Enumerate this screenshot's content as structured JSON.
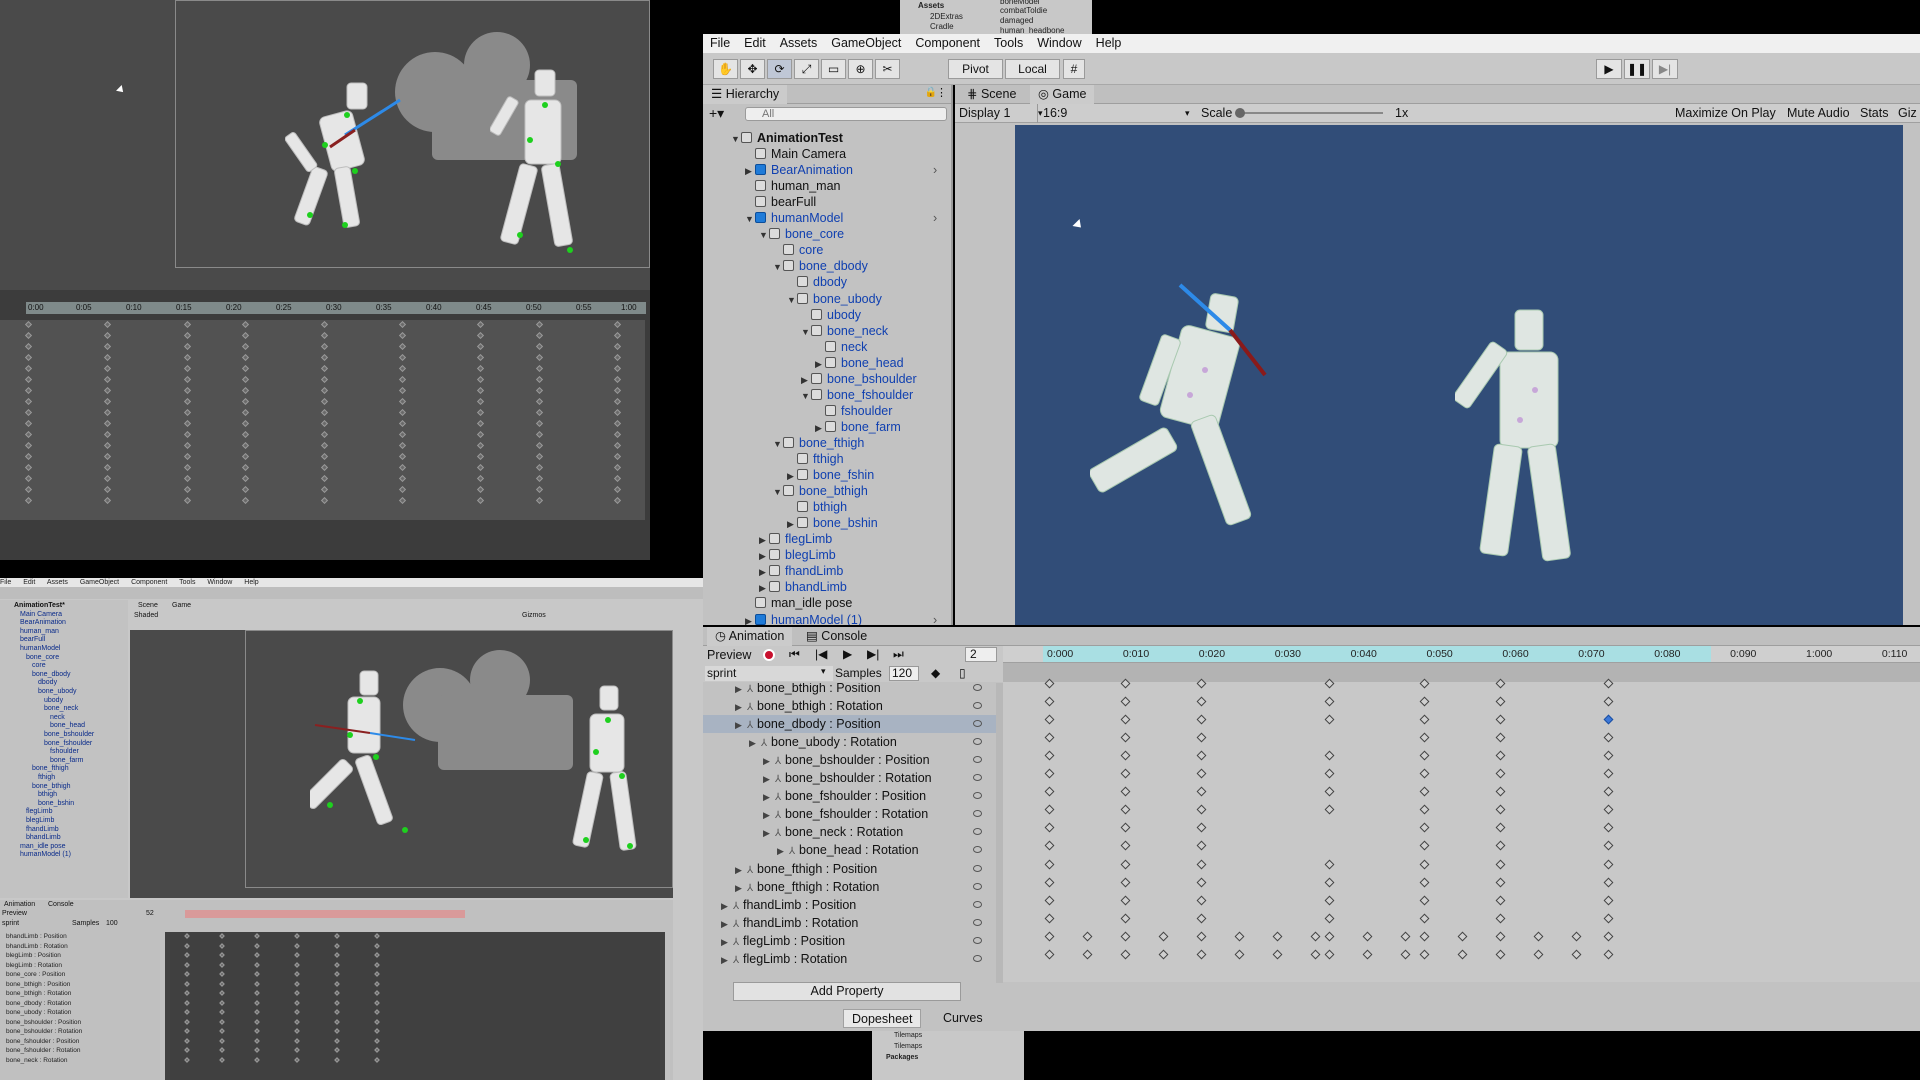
{
  "top_left": {
    "ruler_labels": [
      "0:00",
      "0:05",
      "0:10",
      "0:15",
      "0:20",
      "0:25",
      "0:30",
      "0:35",
      "0:40",
      "0:45",
      "0:50",
      "0:55",
      "1:00"
    ]
  },
  "bottom_left": {
    "menu": [
      "File",
      "Edit",
      "Assets",
      "GameObject",
      "Component",
      "Tools",
      "Window",
      "Help"
    ],
    "hierarchy": [
      "AnimationTest*",
      "Main Camera",
      "BearAnimation",
      "human_man",
      "bearFull",
      "humanModel",
      "bone_core",
      "core",
      "bone_dbody",
      "dbody",
      "bone_ubody",
      "ubody",
      "bone_neck",
      "neck",
      "bone_head",
      "bone_bshoulder",
      "bone_fshoulder",
      "fshoulder",
      "bone_farm",
      "bone_fthigh",
      "fthigh",
      "bone_bthigh",
      "bthigh",
      "bone_bshin",
      "flegLimb",
      "blegLimb",
      "fhandLimb",
      "bhandLimb",
      "man_idle pose",
      "humanModel (1)"
    ],
    "scene_tabs": [
      "Scene",
      "Game"
    ],
    "shading": "Shaded",
    "gizmos": "Gizmos",
    "anim_tabs": [
      "Animation",
      "Console"
    ],
    "preview": "Preview",
    "clip": "sprint",
    "samples_label": "Samples",
    "samples": "100",
    "frame": "52",
    "props": [
      "bhandLimb : Position",
      "bhandLimb : Rotation",
      "blegLimb : Position",
      "blegLimb : Rotation",
      "bone_core : Position",
      "bone_bthigh : Position",
      "bone_bthigh : Rotation",
      "bone_dbody : Rotation",
      "bone_ubody : Rotation",
      "bone_bshoulder : Position",
      "bone_bshoulder : Rotation",
      "bone_fshoulder : Position",
      "bone_fshoulder : Rotation",
      "bone_neck : Rotation"
    ]
  },
  "project_strip": {
    "items": [
      "Assets",
      "2DExtras",
      "Cradle",
      "boneModel",
      "combatToldie",
      "damaged",
      "human_headbone"
    ]
  },
  "menubar": [
    "File",
    "Edit",
    "Assets",
    "GameObject",
    "Component",
    "Tools",
    "Window",
    "Help"
  ],
  "toolbar": {
    "pivot": "Pivot",
    "local": "Local"
  },
  "hierarchy": {
    "tab": "Hierarchy",
    "search_placeholder": "All",
    "items": [
      {
        "label": "AnimationTest",
        "depth": 0,
        "expand": "open",
        "icon": "scene",
        "bold": true
      },
      {
        "label": "Main Camera",
        "depth": 1,
        "expand": "none",
        "icon": "cube"
      },
      {
        "label": "BearAnimation",
        "depth": 1,
        "expand": "closed",
        "icon": "prefab",
        "blue": true,
        "arrow": true
      },
      {
        "label": "human_man",
        "depth": 1,
        "expand": "none",
        "icon": "cube"
      },
      {
        "label": "bearFull",
        "depth": 1,
        "expand": "none",
        "icon": "cube"
      },
      {
        "label": "humanModel",
        "depth": 1,
        "expand": "open",
        "icon": "prefab",
        "blue": true,
        "arrow": true
      },
      {
        "label": "bone_core",
        "depth": 2,
        "expand": "open",
        "icon": "cube",
        "blue": true
      },
      {
        "label": "core",
        "depth": 3,
        "expand": "none",
        "icon": "cube",
        "blue": true
      },
      {
        "label": "bone_dbody",
        "depth": 3,
        "expand": "open",
        "icon": "cube",
        "blue": true
      },
      {
        "label": "dbody",
        "depth": 4,
        "expand": "none",
        "icon": "cube",
        "blue": true
      },
      {
        "label": "bone_ubody",
        "depth": 4,
        "expand": "open",
        "icon": "cube",
        "blue": true
      },
      {
        "label": "ubody",
        "depth": 5,
        "expand": "none",
        "icon": "cube",
        "blue": true
      },
      {
        "label": "bone_neck",
        "depth": 5,
        "expand": "open",
        "icon": "cube",
        "blue": true
      },
      {
        "label": "neck",
        "depth": 6,
        "expand": "none",
        "icon": "cube",
        "blue": true
      },
      {
        "label": "bone_head",
        "depth": 6,
        "expand": "closed",
        "icon": "cube",
        "blue": true
      },
      {
        "label": "bone_bshoulder",
        "depth": 5,
        "expand": "closed",
        "icon": "cube",
        "blue": true
      },
      {
        "label": "bone_fshoulder",
        "depth": 5,
        "expand": "open",
        "icon": "cube",
        "blue": true
      },
      {
        "label": "fshoulder",
        "depth": 6,
        "expand": "none",
        "icon": "cube",
        "blue": true
      },
      {
        "label": "bone_farm",
        "depth": 6,
        "expand": "closed",
        "icon": "cube",
        "blue": true
      },
      {
        "label": "bone_fthigh",
        "depth": 3,
        "expand": "open",
        "icon": "cube",
        "blue": true
      },
      {
        "label": "fthigh",
        "depth": 4,
        "expand": "none",
        "icon": "cube",
        "blue": true
      },
      {
        "label": "bone_fshin",
        "depth": 4,
        "expand": "closed",
        "icon": "cube",
        "blue": true
      },
      {
        "label": "bone_bthigh",
        "depth": 3,
        "expand": "open",
        "icon": "cube",
        "blue": true
      },
      {
        "label": "bthigh",
        "depth": 4,
        "expand": "none",
        "icon": "cube",
        "blue": true
      },
      {
        "label": "bone_bshin",
        "depth": 4,
        "expand": "closed",
        "icon": "cube",
        "blue": true
      },
      {
        "label": "flegLimb",
        "depth": 2,
        "expand": "closed",
        "icon": "cube",
        "blue": true
      },
      {
        "label": "blegLimb",
        "depth": 2,
        "expand": "closed",
        "icon": "cube",
        "blue": true
      },
      {
        "label": "fhandLimb",
        "depth": 2,
        "expand": "closed",
        "icon": "cube",
        "blue": true
      },
      {
        "label": "bhandLimb",
        "depth": 2,
        "expand": "closed",
        "icon": "cube",
        "blue": true
      },
      {
        "label": "man_idle pose",
        "depth": 1,
        "expand": "none",
        "icon": "cube"
      },
      {
        "label": "humanModel (1)",
        "depth": 1,
        "expand": "closed",
        "icon": "prefab",
        "blue": true,
        "arrow": true
      }
    ]
  },
  "game": {
    "tabs": [
      "Scene",
      "Game"
    ],
    "display": "Display 1",
    "aspect": "16:9",
    "scale_label": "Scale",
    "scale_value": "1x",
    "maximize": "Maximize On Play",
    "mute": "Mute Audio",
    "stats": "Stats",
    "gizmos": "Giz",
    "bg_color": "#314d78"
  },
  "animation": {
    "tabs": [
      "Animation",
      "Console"
    ],
    "preview": "Preview",
    "frame": "2",
    "clip": "sprint",
    "samples_label": "Samples",
    "samples": "120",
    "ruler": [
      "0:000",
      "0:010",
      "0:020",
      "0:030",
      "0:040",
      "0:050",
      "0:060",
      "0:070",
      "0:080",
      "0:090",
      "1:000",
      "0:110"
    ],
    "properties": [
      {
        "label": "bone_bthigh : Position",
        "depth": 1
      },
      {
        "label": "bone_bthigh : Rotation",
        "depth": 1
      },
      {
        "label": "bone_dbody : Position",
        "depth": 1,
        "selected": true
      },
      {
        "label": "bone_ubody : Rotation",
        "depth": 2
      },
      {
        "label": "bone_bshoulder : Position",
        "depth": 3
      },
      {
        "label": "bone_bshoulder : Rotation",
        "depth": 3
      },
      {
        "label": "bone_fshoulder : Position",
        "depth": 3
      },
      {
        "label": "bone_fshoulder : Rotation",
        "depth": 3
      },
      {
        "label": "bone_neck : Rotation",
        "depth": 3
      },
      {
        "label": "bone_head : Rotation",
        "depth": 4
      },
      {
        "label": "bone_fthigh : Position",
        "depth": 1
      },
      {
        "label": "bone_fthigh : Rotation",
        "depth": 1
      },
      {
        "label": "fhandLimb : Position",
        "depth": 0
      },
      {
        "label": "fhandLimb : Rotation",
        "depth": 0
      },
      {
        "label": "flegLimb : Position",
        "depth": 0
      },
      {
        "label": "flegLimb : Rotation",
        "depth": 0
      }
    ],
    "add_property": "Add Property",
    "view_tabs": [
      "Dopesheet",
      "Curves"
    ]
  },
  "bottom_assets": [
    "Tilemaps",
    "Tilemaps",
    "Packages"
  ]
}
